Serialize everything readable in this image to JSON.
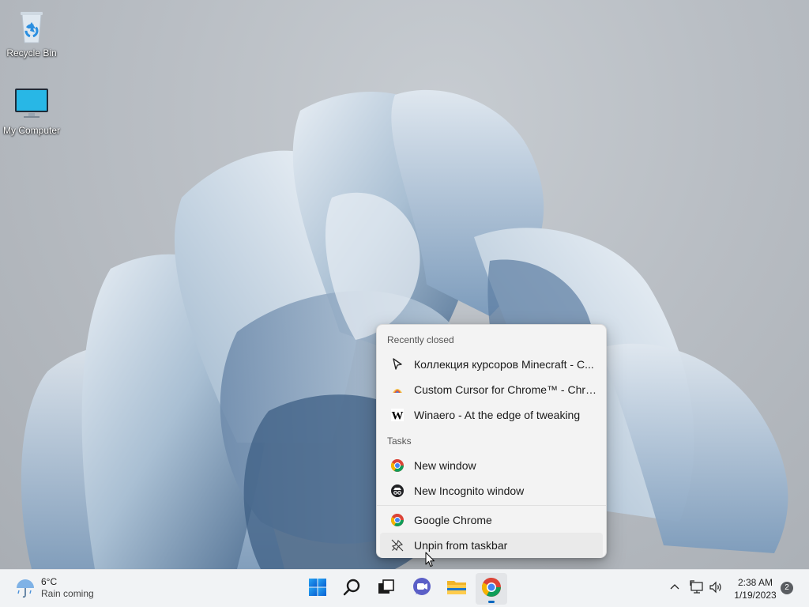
{
  "desktop": {
    "icons": [
      {
        "label": "Recycle Bin",
        "icon": "recycle-bin-icon"
      },
      {
        "label": "My Computer",
        "icon": "monitor-icon"
      }
    ]
  },
  "jumplist": {
    "recent_header": "Recently closed",
    "recent": [
      {
        "label": "Коллекция курсоров Minecraft - C...",
        "icon": "cursor-arrow-icon"
      },
      {
        "label": "Custom Cursor for Chrome™ - Chro...",
        "icon": "custom-cursor-icon"
      },
      {
        "label": "Winaero - At the edge of tweaking",
        "icon": "winaero-w-icon"
      }
    ],
    "tasks_header": "Tasks",
    "tasks": [
      {
        "label": "New window",
        "icon": "chrome-icon"
      },
      {
        "label": "New Incognito window",
        "icon": "incognito-icon"
      }
    ],
    "app": {
      "label": "Google Chrome",
      "icon": "chrome-icon"
    },
    "unpin": {
      "label": "Unpin from taskbar",
      "icon": "unpin-icon"
    }
  },
  "taskbar": {
    "weather": {
      "temp": "6°C",
      "condition": "Rain coming",
      "icon": "rain-umbrella-icon"
    },
    "apps": [
      {
        "name": "start-button",
        "icon": "windows-logo-icon"
      },
      {
        "name": "search-button",
        "icon": "search-icon"
      },
      {
        "name": "task-view-button",
        "icon": "task-view-icon"
      },
      {
        "name": "teams-chat-button",
        "icon": "teams-chat-icon"
      },
      {
        "name": "file-explorer-button",
        "icon": "folder-icon"
      },
      {
        "name": "chrome-taskbar-button",
        "icon": "chrome-icon",
        "active": true
      }
    ],
    "tray": {
      "time": "2:38 AM",
      "date": "1/19/2023",
      "notifications": "2"
    }
  },
  "colors": {
    "accent": "#0067c0",
    "menu_bg": "#f3f3f3",
    "taskbar_bg": "#f1f3f5"
  }
}
